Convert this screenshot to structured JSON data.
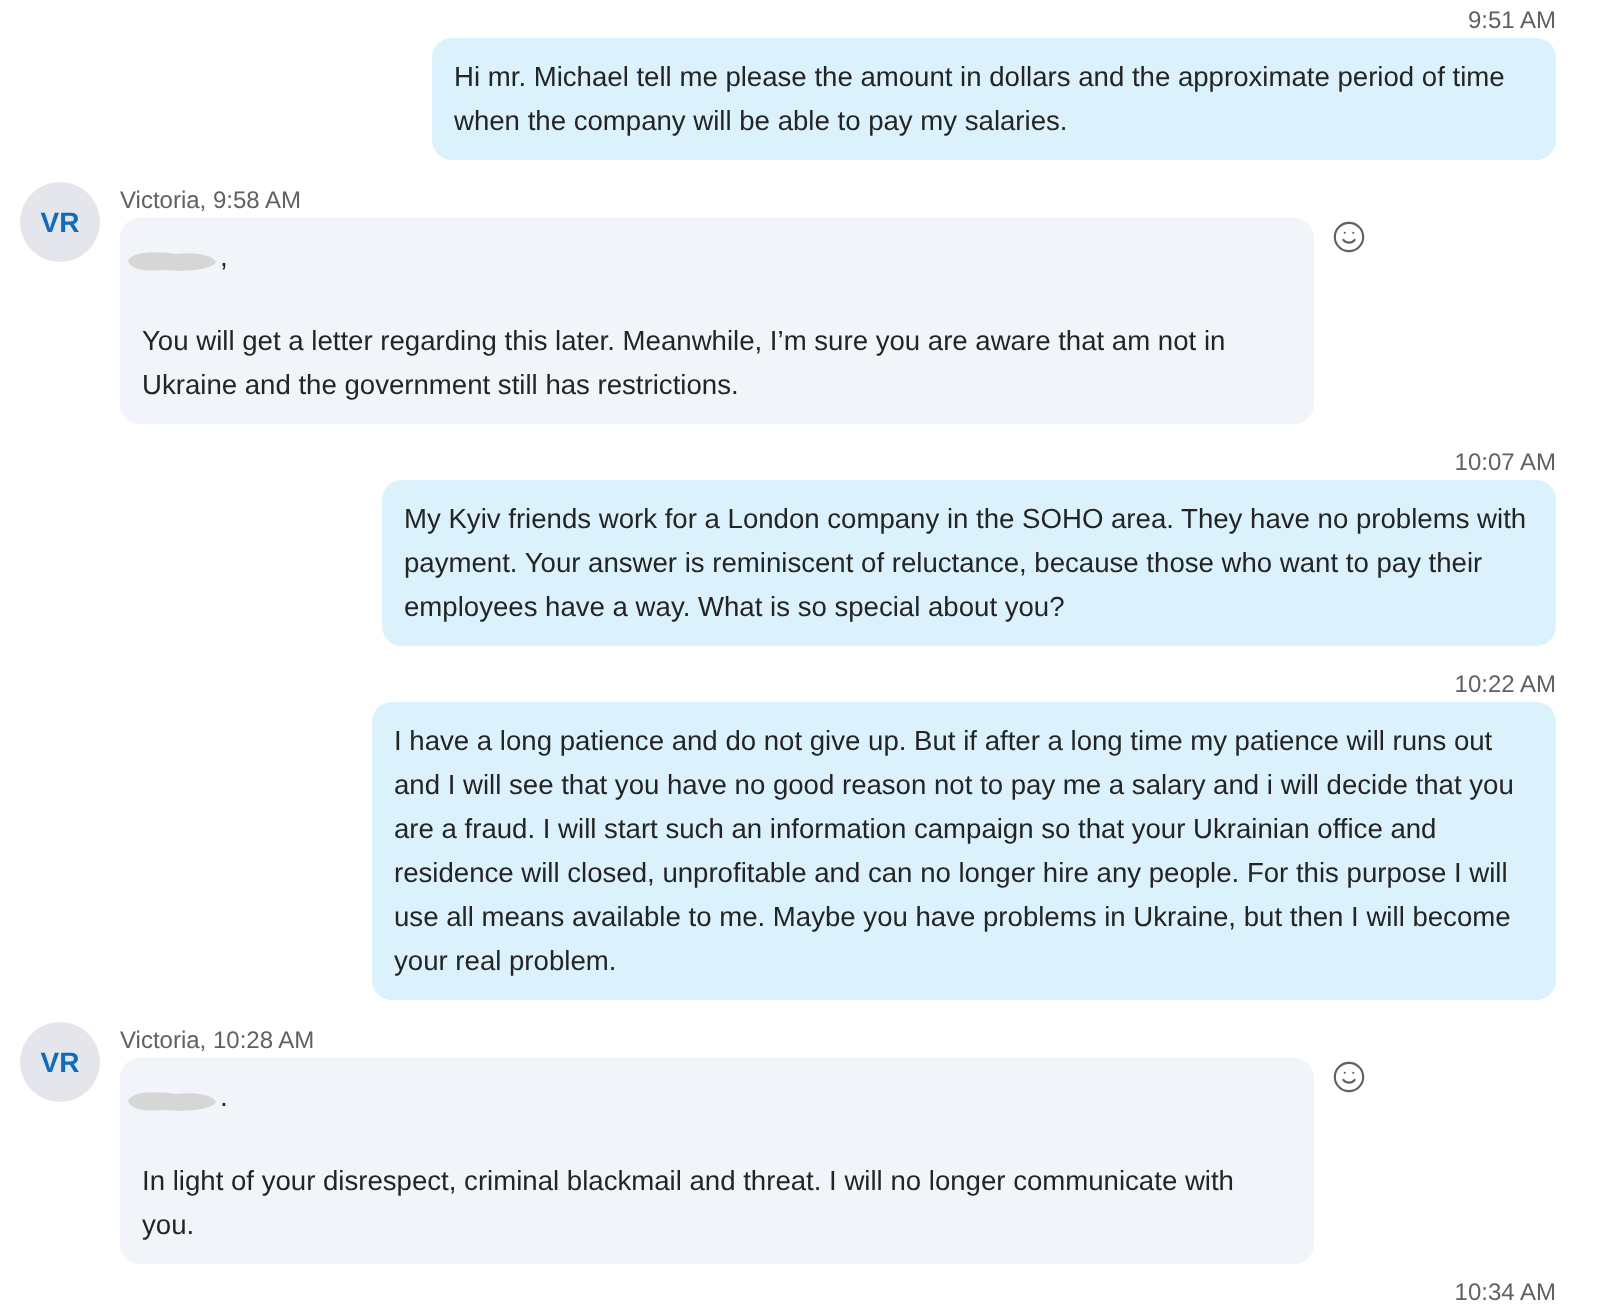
{
  "messages": [
    {
      "kind": "outgoing",
      "time": "9:51 AM",
      "text": "Hi mr. Michael tell me please the amount in dollars and the approximate period of time when the company will be able to pay my salaries."
    },
    {
      "kind": "incoming",
      "avatar": "VR",
      "header": "Victoria, 9:58 AM",
      "greeting_punctuation": ",",
      "text": "You will get a letter regarding this later. Meanwhile, I’m sure you are aware that am not in Ukraine and the government still has restrictions."
    },
    {
      "kind": "outgoing",
      "time": "10:07 AM",
      "text": "My Kyiv friends work for a London company in the SOHO area. They have no problems with payment. Your answer is reminiscent of reluctance, because those who want to pay their employees have a way. What is so special about you?"
    },
    {
      "kind": "outgoing",
      "time": "10:22 AM",
      "text": "I have a long patience and do not give up. But if after a long time my patience will runs out and I will see that you have no good reason not to pay me a salary and i will decide that you are a fraud. I will start such an information campaign so that your Ukrainian office and residence will closed, unprofitable and can no longer hire any people. For this purpose I will use all means available to me. Maybe you have problems in Ukraine, but then I will become your real problem."
    },
    {
      "kind": "incoming",
      "avatar": "VR",
      "header": "Victoria, 10:28 AM",
      "greeting_punctuation": ".",
      "text": "In light of your disrespect, criminal blackmail and threat. I will no longer communicate with you."
    }
  ],
  "trailing_time": "10:34 AM"
}
